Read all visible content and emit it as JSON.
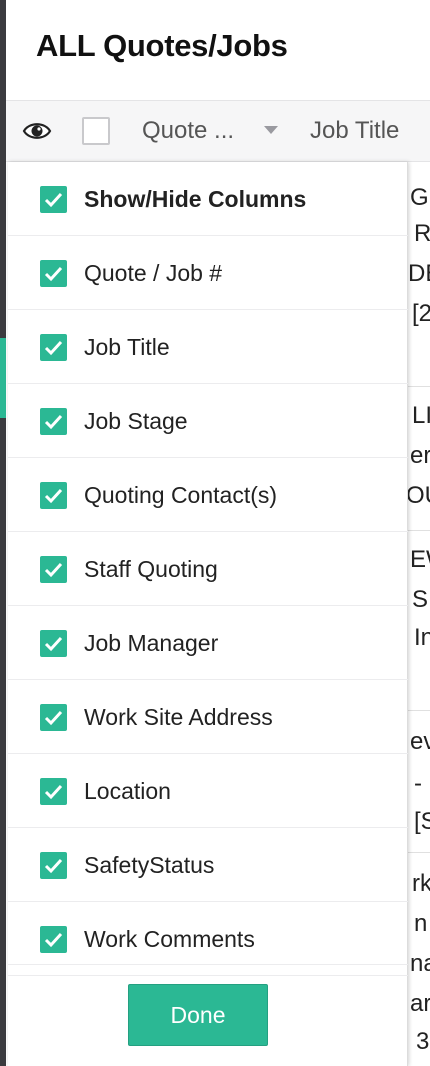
{
  "header": {
    "title": "ALL Quotes/Jobs"
  },
  "columns_header": {
    "quote_label": "Quote ...",
    "job_title_label": "Job Title"
  },
  "background_rows": [
    {
      "text": "G I"
    },
    {
      "text": "R"
    },
    {
      "text": "DE"
    },
    {
      "text": "[2"
    },
    {
      "text": "LI"
    },
    {
      "text": "er"
    },
    {
      "text": "OU"
    },
    {
      "text": "EW"
    },
    {
      "text": "S"
    },
    {
      "text": "In"
    },
    {
      "text": "ev"
    },
    {
      "text": "-"
    },
    {
      "text": "[S"
    },
    {
      "text": "rk"
    },
    {
      "text": "n F"
    },
    {
      "text": "na"
    },
    {
      "text": "ar"
    },
    {
      "text": "3"
    }
  ],
  "column_options": [
    {
      "label": "Show/Hide Columns",
      "checked": true
    },
    {
      "label": "Quote / Job #",
      "checked": true
    },
    {
      "label": "Job Title",
      "checked": true
    },
    {
      "label": "Job Stage",
      "checked": true
    },
    {
      "label": "Quoting Contact(s)",
      "checked": true
    },
    {
      "label": "Staff Quoting",
      "checked": true
    },
    {
      "label": "Job Manager",
      "checked": true
    },
    {
      "label": "Work Site Address",
      "checked": true
    },
    {
      "label": "Location",
      "checked": true
    },
    {
      "label": "SafetyStatus",
      "checked": true
    },
    {
      "label": "Work Comments",
      "checked": true
    }
  ],
  "done_label": "Done",
  "colors": {
    "accent": "#2bb894",
    "sidebar": "#3b3b3f"
  }
}
